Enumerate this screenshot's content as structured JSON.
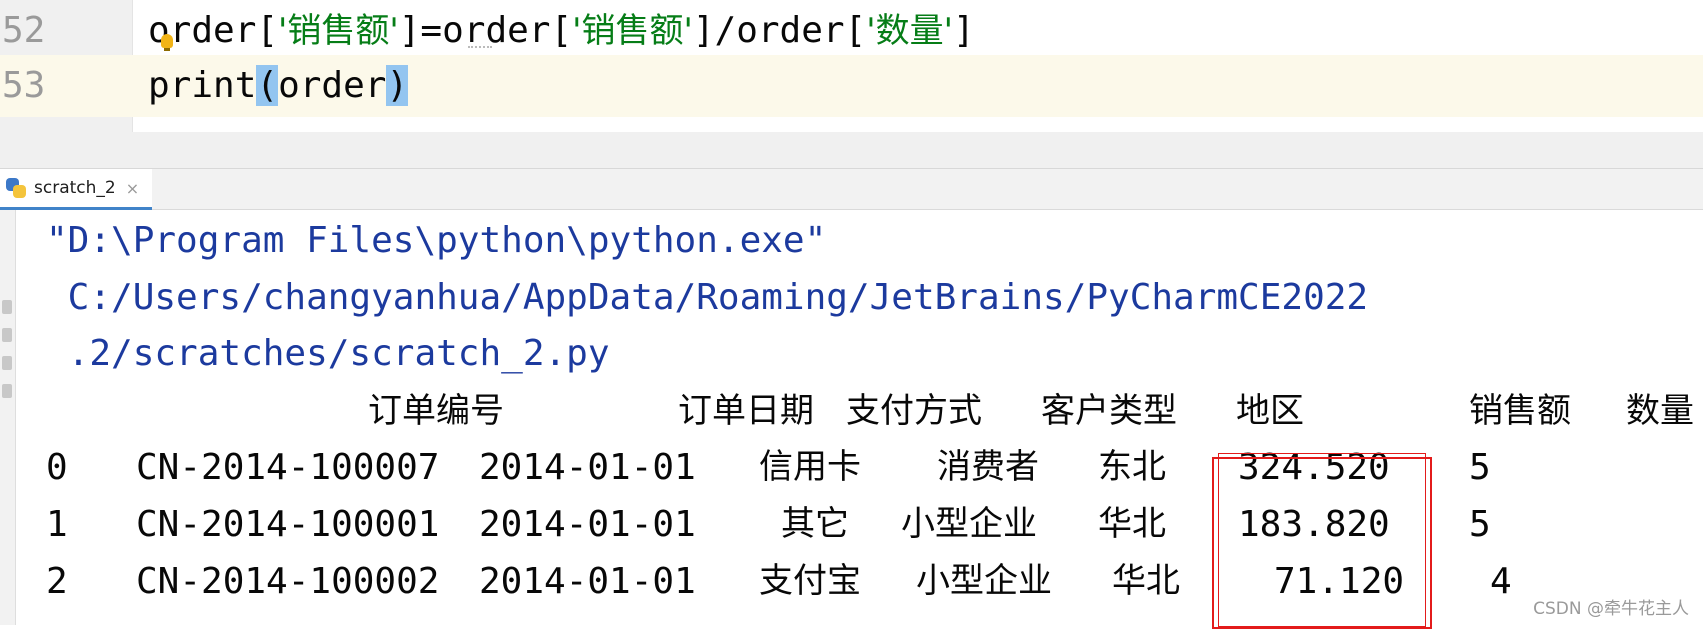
{
  "editor": {
    "lines": [
      {
        "number": "52",
        "parts": [
          "order[",
          "'销售额'",
          "]=order[",
          "'销售额'",
          "]/order[",
          "'数量'",
          "]"
        ]
      },
      {
        "number": "53",
        "parts": [
          "print",
          "(",
          "order",
          ")"
        ]
      }
    ]
  },
  "run_tab": {
    "label": "scratch_2",
    "close": "×"
  },
  "console": {
    "command_lines": [
      "\"D:\\Program Files\\python\\python.exe\"",
      " C:/Users/changyanhua/AppData/Roaming/JetBrains/PyCharmCE2022",
      " .2/scratches/scratch_2.py"
    ],
    "table": {
      "headers": [
        "订单编号",
        "订单日期",
        "支付方式",
        "客户类型",
        "地区",
        "销售额",
        "数量"
      ],
      "rows": [
        {
          "index": "0",
          "order_id": "CN-2014-100007",
          "date": "2014-01-01",
          "payment": "信用卡",
          "customer": "消费者",
          "region": "东北",
          "sales": "324.520",
          "qty": "5"
        },
        {
          "index": "1",
          "order_id": "CN-2014-100001",
          "date": "2014-01-01",
          "payment": "其它",
          "customer": "小型企业",
          "region": "华北",
          "sales": "183.820",
          "qty": "5"
        },
        {
          "index": "2",
          "order_id": "CN-2014-100002",
          "date": "2014-01-01",
          "payment": "支付宝",
          "customer": "小型企业",
          "region": "华北",
          "sales": "71.120",
          "qty": "4"
        }
      ]
    }
  },
  "watermark": "CSDN @牵牛花主人",
  "colors": {
    "string": "#067d17",
    "console_path": "#1c3a9e",
    "highlight_box": "#e31b1b",
    "current_line": "#fcf9ea",
    "brace_match": "#93c5f0"
  },
  "icons": [
    "intention-bulb-icon",
    "python-file-icon",
    "close-icon"
  ]
}
